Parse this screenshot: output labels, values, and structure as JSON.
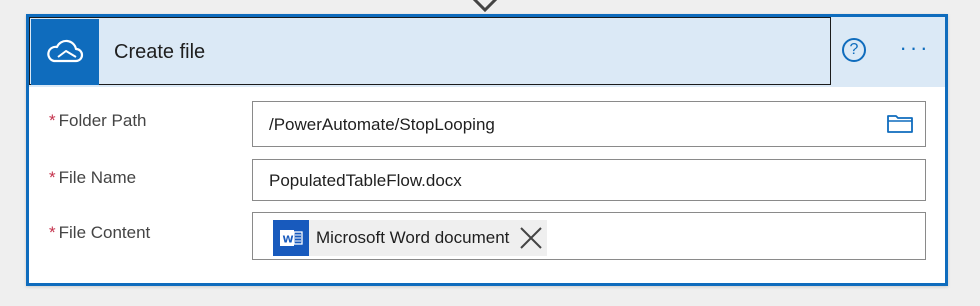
{
  "card": {
    "title": "Create file",
    "help_label": "?",
    "more_label": "···"
  },
  "fields": [
    {
      "label": "Folder Path",
      "required": "*",
      "value": "/PowerAutomate/StopLooping"
    },
    {
      "label": "File Name",
      "required": "*",
      "value": "PopulatedTableFlow.docx"
    },
    {
      "label": "File Content",
      "required": "*",
      "token": "Microsoft Word document"
    }
  ],
  "icons": {
    "app": "onedrive-cloud-icon",
    "folder": "folder-icon",
    "word": "word-icon",
    "close": "close-icon"
  },
  "colors": {
    "accent": "#0f6cbd",
    "header_bg": "#dbe9f6",
    "required": "#c4314b",
    "word_blue": "#185abd"
  }
}
